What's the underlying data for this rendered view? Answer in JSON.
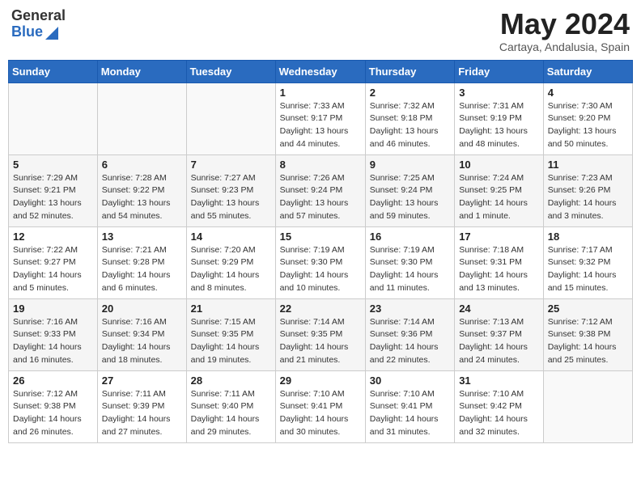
{
  "header": {
    "logo_general": "General",
    "logo_blue": "Blue",
    "month_title": "May 2024",
    "location": "Cartaya, Andalusia, Spain"
  },
  "days_of_week": [
    "Sunday",
    "Monday",
    "Tuesday",
    "Wednesday",
    "Thursday",
    "Friday",
    "Saturday"
  ],
  "weeks": [
    [
      {
        "day": "",
        "info": ""
      },
      {
        "day": "",
        "info": ""
      },
      {
        "day": "",
        "info": ""
      },
      {
        "day": "1",
        "info": "Sunrise: 7:33 AM\nSunset: 9:17 PM\nDaylight: 13 hours\nand 44 minutes."
      },
      {
        "day": "2",
        "info": "Sunrise: 7:32 AM\nSunset: 9:18 PM\nDaylight: 13 hours\nand 46 minutes."
      },
      {
        "day": "3",
        "info": "Sunrise: 7:31 AM\nSunset: 9:19 PM\nDaylight: 13 hours\nand 48 minutes."
      },
      {
        "day": "4",
        "info": "Sunrise: 7:30 AM\nSunset: 9:20 PM\nDaylight: 13 hours\nand 50 minutes."
      }
    ],
    [
      {
        "day": "5",
        "info": "Sunrise: 7:29 AM\nSunset: 9:21 PM\nDaylight: 13 hours\nand 52 minutes."
      },
      {
        "day": "6",
        "info": "Sunrise: 7:28 AM\nSunset: 9:22 PM\nDaylight: 13 hours\nand 54 minutes."
      },
      {
        "day": "7",
        "info": "Sunrise: 7:27 AM\nSunset: 9:23 PM\nDaylight: 13 hours\nand 55 minutes."
      },
      {
        "day": "8",
        "info": "Sunrise: 7:26 AM\nSunset: 9:24 PM\nDaylight: 13 hours\nand 57 minutes."
      },
      {
        "day": "9",
        "info": "Sunrise: 7:25 AM\nSunset: 9:24 PM\nDaylight: 13 hours\nand 59 minutes."
      },
      {
        "day": "10",
        "info": "Sunrise: 7:24 AM\nSunset: 9:25 PM\nDaylight: 14 hours\nand 1 minute."
      },
      {
        "day": "11",
        "info": "Sunrise: 7:23 AM\nSunset: 9:26 PM\nDaylight: 14 hours\nand 3 minutes."
      }
    ],
    [
      {
        "day": "12",
        "info": "Sunrise: 7:22 AM\nSunset: 9:27 PM\nDaylight: 14 hours\nand 5 minutes."
      },
      {
        "day": "13",
        "info": "Sunrise: 7:21 AM\nSunset: 9:28 PM\nDaylight: 14 hours\nand 6 minutes."
      },
      {
        "day": "14",
        "info": "Sunrise: 7:20 AM\nSunset: 9:29 PM\nDaylight: 14 hours\nand 8 minutes."
      },
      {
        "day": "15",
        "info": "Sunrise: 7:19 AM\nSunset: 9:30 PM\nDaylight: 14 hours\nand 10 minutes."
      },
      {
        "day": "16",
        "info": "Sunrise: 7:19 AM\nSunset: 9:30 PM\nDaylight: 14 hours\nand 11 minutes."
      },
      {
        "day": "17",
        "info": "Sunrise: 7:18 AM\nSunset: 9:31 PM\nDaylight: 14 hours\nand 13 minutes."
      },
      {
        "day": "18",
        "info": "Sunrise: 7:17 AM\nSunset: 9:32 PM\nDaylight: 14 hours\nand 15 minutes."
      }
    ],
    [
      {
        "day": "19",
        "info": "Sunrise: 7:16 AM\nSunset: 9:33 PM\nDaylight: 14 hours\nand 16 minutes."
      },
      {
        "day": "20",
        "info": "Sunrise: 7:16 AM\nSunset: 9:34 PM\nDaylight: 14 hours\nand 18 minutes."
      },
      {
        "day": "21",
        "info": "Sunrise: 7:15 AM\nSunset: 9:35 PM\nDaylight: 14 hours\nand 19 minutes."
      },
      {
        "day": "22",
        "info": "Sunrise: 7:14 AM\nSunset: 9:35 PM\nDaylight: 14 hours\nand 21 minutes."
      },
      {
        "day": "23",
        "info": "Sunrise: 7:14 AM\nSunset: 9:36 PM\nDaylight: 14 hours\nand 22 minutes."
      },
      {
        "day": "24",
        "info": "Sunrise: 7:13 AM\nSunset: 9:37 PM\nDaylight: 14 hours\nand 24 minutes."
      },
      {
        "day": "25",
        "info": "Sunrise: 7:12 AM\nSunset: 9:38 PM\nDaylight: 14 hours\nand 25 minutes."
      }
    ],
    [
      {
        "day": "26",
        "info": "Sunrise: 7:12 AM\nSunset: 9:38 PM\nDaylight: 14 hours\nand 26 minutes."
      },
      {
        "day": "27",
        "info": "Sunrise: 7:11 AM\nSunset: 9:39 PM\nDaylight: 14 hours\nand 27 minutes."
      },
      {
        "day": "28",
        "info": "Sunrise: 7:11 AM\nSunset: 9:40 PM\nDaylight: 14 hours\nand 29 minutes."
      },
      {
        "day": "29",
        "info": "Sunrise: 7:10 AM\nSunset: 9:41 PM\nDaylight: 14 hours\nand 30 minutes."
      },
      {
        "day": "30",
        "info": "Sunrise: 7:10 AM\nSunset: 9:41 PM\nDaylight: 14 hours\nand 31 minutes."
      },
      {
        "day": "31",
        "info": "Sunrise: 7:10 AM\nSunset: 9:42 PM\nDaylight: 14 hours\nand 32 minutes."
      },
      {
        "day": "",
        "info": ""
      }
    ]
  ]
}
